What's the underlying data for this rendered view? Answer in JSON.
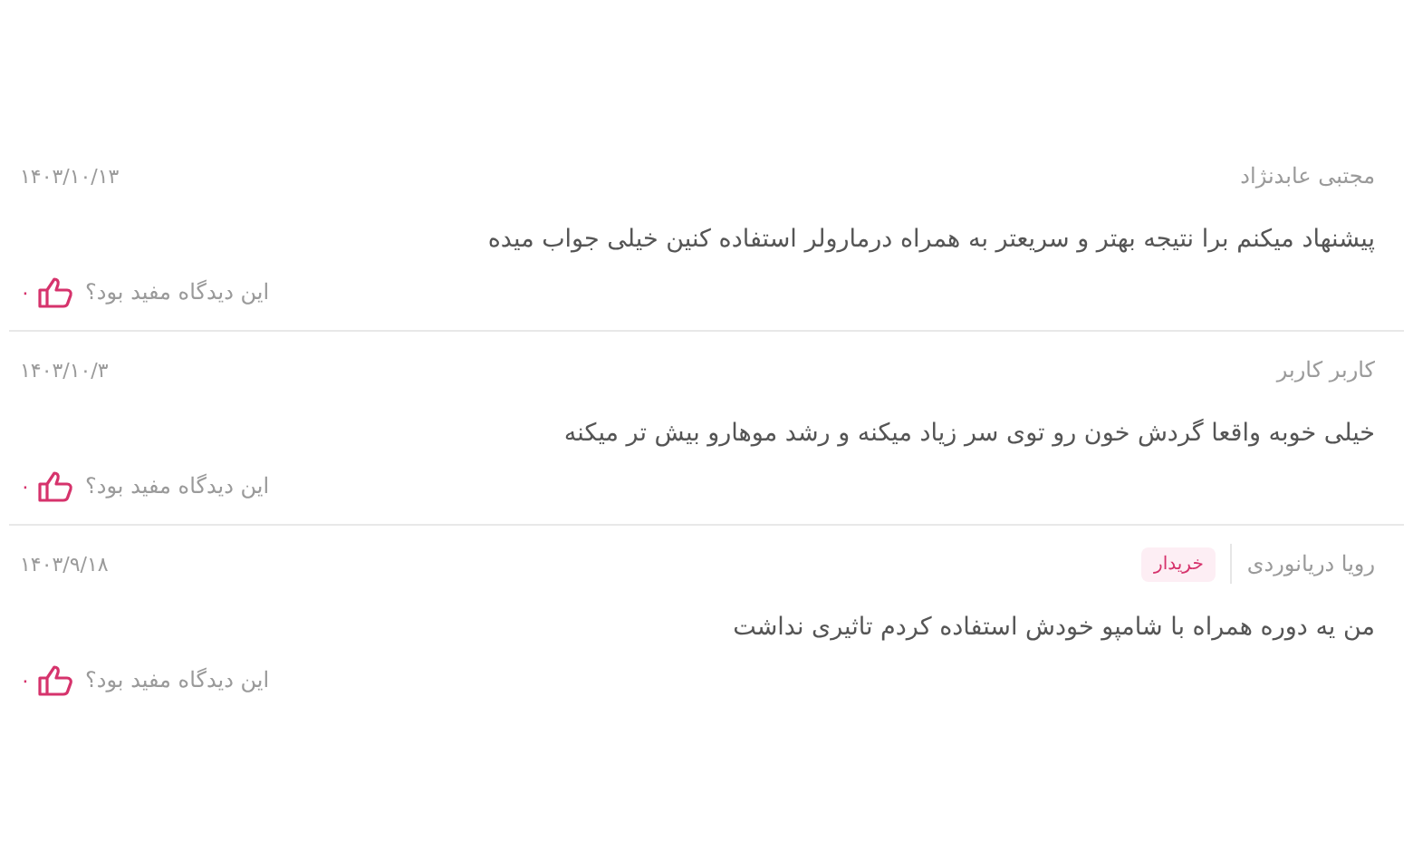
{
  "reviews": [
    {
      "author": "مجتبی عابدنژاد",
      "date": "۱۴۰۳/۱۰/۱۳",
      "text": "پیشنهاد میکنم برا نتیجه بهتر و سریعتر به همراه درمارولر استفاده کنین خیلی جواب میده",
      "helpful_prompt": "این دیدگاه مفید بود؟",
      "likes": "۰"
    },
    {
      "author": "کاربر کاربر",
      "date": "۱۴۰۳/۱۰/۳",
      "text": "خیلی خوبه واقعا گردش خون رو توی سر زیاد میکنه و رشد موهارو بیش تر میکنه",
      "helpful_prompt": "این دیدگاه مفید بود؟",
      "likes": "۰"
    },
    {
      "author": "رویا دریانوردی",
      "badge": "خریدار",
      "date": "۱۴۰۳/۹/۱۸",
      "text": "من یه دوره همراه با شامپو خودش استفاده کردم تاثیری نداشت",
      "helpful_prompt": "این دیدگاه مفید بود؟",
      "likes": "۰"
    }
  ]
}
